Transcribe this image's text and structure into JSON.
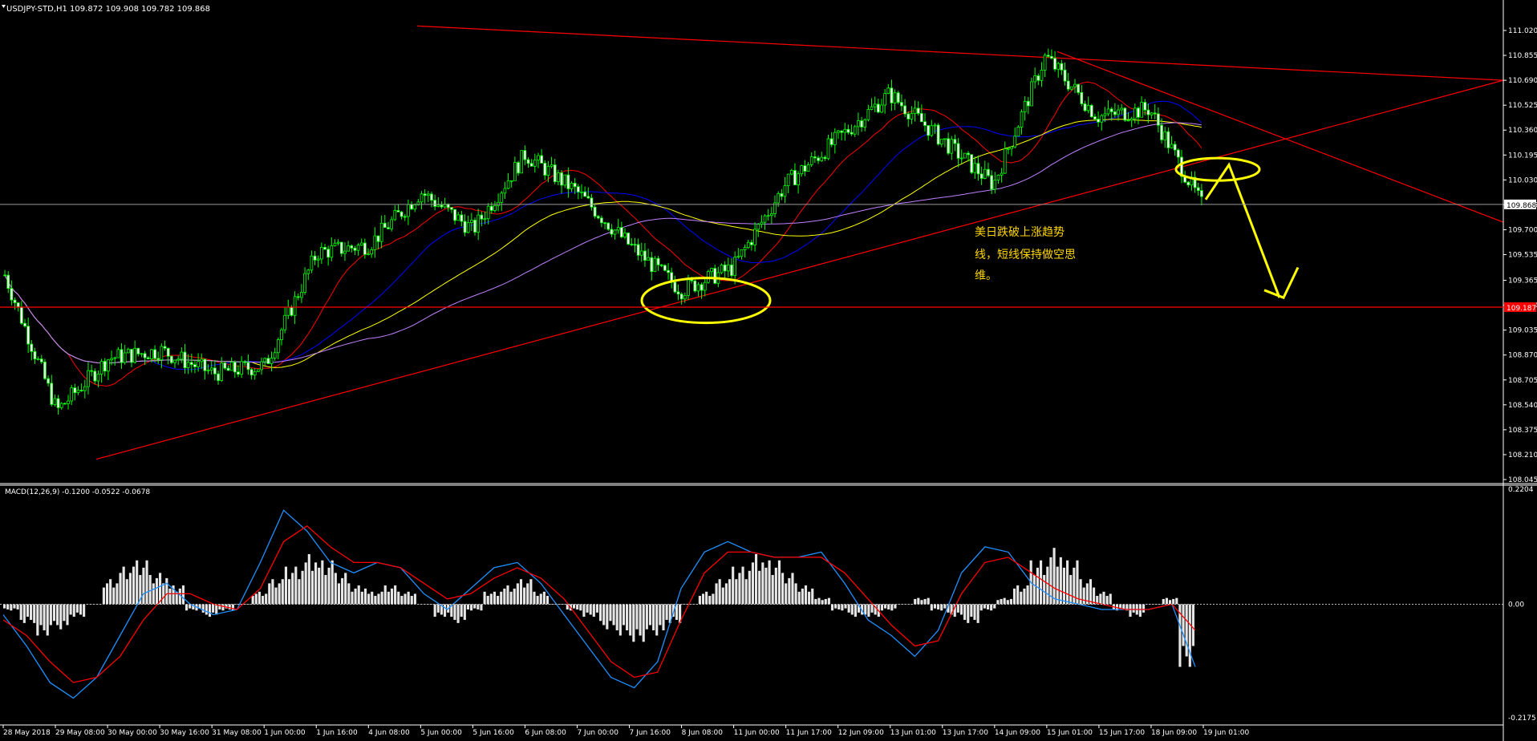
{
  "chart_data": [
    {
      "type": "candlestick",
      "title": "USDJPY-STD,H1  109.872 109.908 109.782 109.868",
      "symbol": "USDJPY-STD",
      "timeframe": "H1",
      "ohlc_last": {
        "open": 109.872,
        "high": 109.908,
        "low": 109.782,
        "close": 109.868
      },
      "y_ticks": [
        "111.020",
        "110.855",
        "110.690",
        "110.525",
        "110.360",
        "110.195",
        "110.030",
        "109.865",
        "109.700",
        "109.535",
        "109.365",
        "109.200",
        "109.035",
        "108.870",
        "108.705",
        "108.540",
        "108.375",
        "108.210",
        "108.045"
      ],
      "ylim": [
        108.045,
        111.02
      ],
      "x_ticks": [
        "28 May 2018",
        "29 May 08:00",
        "30 May 00:00",
        "30 May 16:00",
        "31 May 08:00",
        "1 Jun 00:00",
        "1 Jun 16:00",
        "4 Jun 08:00",
        "5 Jun 00:00",
        "5 Jun 16:00",
        "6 Jun 08:00",
        "7 Jun 00:00",
        "7 Jun 16:00",
        "8 Jun 08:00",
        "11 Jun 00:00",
        "11 Jun 17:00",
        "12 Jun 09:00",
        "13 Jun 01:00",
        "13 Jun 17:00",
        "14 Jun 09:00",
        "15 Jun 01:00",
        "15 Jun 17:00",
        "18 Jun 09:00",
        "19 Jun 01:00"
      ],
      "price_label_current": "109.868",
      "price_label_level": "109.187",
      "price_close_path": [
        {
          "x": "28 May 2018",
          "y": 109.4
        },
        {
          "x": "29 May 08:00",
          "y": 108.5
        },
        {
          "x": "30 May 00:00",
          "y": 108.85
        },
        {
          "x": "30 May 16:00",
          "y": 108.9
        },
        {
          "x": "31 May 08:00",
          "y": 108.75
        },
        {
          "x": "1 Jun 00:00",
          "y": 108.8
        },
        {
          "x": "1 Jun 16:00",
          "y": 109.55
        },
        {
          "x": "4 Jun 08:00",
          "y": 109.6
        },
        {
          "x": "5 Jun 00:00",
          "y": 109.95
        },
        {
          "x": "5 Jun 16:00",
          "y": 109.7
        },
        {
          "x": "6 Jun 08:00",
          "y": 110.2
        },
        {
          "x": "7 Jun 00:00",
          "y": 109.95
        },
        {
          "x": "7 Jun 16:00",
          "y": 109.6
        },
        {
          "x": "8 Jun 08:00",
          "y": 109.3
        },
        {
          "x": "11 Jun 00:00",
          "y": 109.45
        },
        {
          "x": "11 Jun 17:00",
          "y": 110.0
        },
        {
          "x": "12 Jun 09:00",
          "y": 110.3
        },
        {
          "x": "13 Jun 01:00",
          "y": 110.6
        },
        {
          "x": "13 Jun 17:00",
          "y": 110.3
        },
        {
          "x": "14 Jun 09:00",
          "y": 110.0
        },
        {
          "x": "15 Jun 01:00",
          "y": 110.85
        },
        {
          "x": "15 Jun 17:00",
          "y": 110.45
        },
        {
          "x": "18 Jun 09:00",
          "y": 110.5
        },
        {
          "x": "19 Jun 01:00",
          "y": 109.868
        }
      ],
      "annotation_text": [
        "美日跌破上涨趋势",
        "线，短线保持做空思",
        "维。"
      ],
      "colors": {
        "candle": "#00ff00",
        "trendline": "#ff0000",
        "annotation": "#ffff00",
        "ma_red": "#ff0000",
        "ma_blue": "#0000ff",
        "ma_yellow": "#ffff00",
        "ma_violet": "#c080ff"
      }
    },
    {
      "type": "macd",
      "label": "MACD(12,26,9) -0.1200 -0.0522 -0.0678",
      "y_ticks": [
        "0.2204",
        "0.00",
        "-0.2175"
      ],
      "ylim": [
        -0.2175,
        0.2204
      ],
      "histogram": [
        -0.01,
        -0.03,
        -0.05,
        -0.04,
        -0.02,
        0.0,
        0.04,
        0.06,
        0.07,
        0.05,
        0.03,
        -0.01,
        -0.02,
        -0.01,
        0.0,
        0.02,
        0.04,
        0.06,
        0.08,
        0.07,
        0.05,
        0.03,
        0.02,
        0.03,
        0.02,
        0.0,
        -0.02,
        -0.03,
        -0.01,
        0.02,
        0.03,
        0.04,
        0.02,
        0.0,
        -0.01,
        -0.02,
        -0.04,
        -0.05,
        -0.06,
        -0.05,
        -0.03,
        0.0,
        0.02,
        0.04,
        0.06,
        0.08,
        0.07,
        0.05,
        0.03,
        0.01,
        -0.01,
        -0.02,
        -0.02,
        -0.01,
        0.0,
        0.01,
        -0.01,
        -0.02,
        -0.03,
        -0.01,
        0.01,
        0.03,
        0.07,
        0.09,
        0.07,
        0.04,
        0.02,
        -0.01,
        -0.02,
        0.0,
        0.01,
        -0.1
      ],
      "macd_line": [
        -0.02,
        -0.08,
        -0.15,
        -0.18,
        -0.14,
        -0.06,
        0.02,
        0.04,
        0.0,
        -0.02,
        -0.01,
        0.08,
        0.18,
        0.14,
        0.08,
        0.06,
        0.08,
        0.07,
        0.02,
        -0.01,
        0.03,
        0.07,
        0.08,
        0.04,
        -0.02,
        -0.08,
        -0.14,
        -0.16,
        -0.11,
        0.03,
        0.1,
        0.12,
        0.1,
        0.09,
        0.09,
        0.1,
        0.04,
        -0.03,
        -0.06,
        -0.1,
        -0.05,
        0.06,
        0.11,
        0.1,
        0.04,
        0.01,
        0.0,
        -0.01,
        -0.01,
        -0.01,
        0.0,
        -0.12
      ],
      "signal_line": [
        -0.03,
        -0.06,
        -0.11,
        -0.15,
        -0.14,
        -0.1,
        -0.03,
        0.02,
        0.02,
        0.0,
        -0.01,
        0.03,
        0.12,
        0.15,
        0.11,
        0.08,
        0.08,
        0.07,
        0.04,
        0.01,
        0.02,
        0.05,
        0.07,
        0.05,
        0.01,
        -0.05,
        -0.11,
        -0.14,
        -0.13,
        -0.03,
        0.06,
        0.1,
        0.1,
        0.09,
        0.09,
        0.09,
        0.06,
        0.01,
        -0.04,
        -0.08,
        -0.07,
        0.02,
        0.08,
        0.09,
        0.06,
        0.03,
        0.01,
        0.0,
        -0.01,
        -0.01,
        0.0,
        -0.05
      ]
    }
  ]
}
